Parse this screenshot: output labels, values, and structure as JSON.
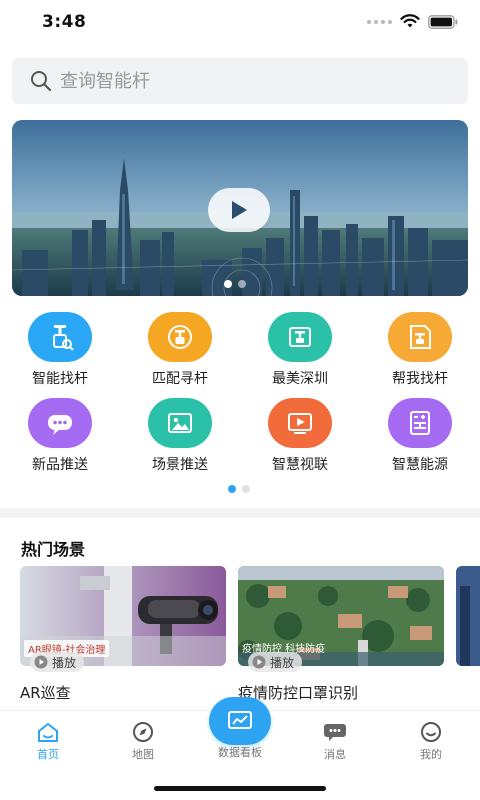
{
  "status_bar": {
    "time": "3:48"
  },
  "search": {
    "placeholder": "查询智能杆"
  },
  "functions": [
    {
      "label": "智能找杆",
      "icon": "pole-search-icon",
      "color": "#2aa7f5"
    },
    {
      "label": "匹配寻杆",
      "icon": "pole-match-icon",
      "color": "#f5a623"
    },
    {
      "label": "最美深圳",
      "icon": "pole-gallery-icon",
      "color": "#2bc1a8"
    },
    {
      "label": "帮我找杆",
      "icon": "pole-document-icon",
      "color": "#f7a935"
    },
    {
      "label": "新品推送",
      "icon": "chat-bubble-icon",
      "color": "#a56bf2"
    },
    {
      "label": "场景推送",
      "icon": "scene-image-icon",
      "color": "#2bc1a8"
    },
    {
      "label": "智慧视联",
      "icon": "video-play-icon",
      "color": "#f26b3a"
    },
    {
      "label": "智慧能源",
      "icon": "battery-grid-icon",
      "color": "#a56bf2"
    }
  ],
  "hot_scenes": {
    "title": "热门场景",
    "play_label": "播放",
    "cards": [
      {
        "title": "AR巡查",
        "tag": "AR眼镜-社会治理"
      },
      {
        "title": "疫情防控口罩识别",
        "tag": "疫情防控  科技防疫"
      }
    ]
  },
  "tabs": [
    {
      "label": "首页",
      "icon": "home-icon",
      "active": true
    },
    {
      "label": "地图",
      "icon": "compass-icon",
      "active": false
    },
    {
      "label": "数据看板",
      "icon": "chart-icon",
      "active": false
    },
    {
      "label": "消息",
      "icon": "message-icon",
      "active": false
    },
    {
      "label": "我的",
      "icon": "profile-icon",
      "active": false
    }
  ],
  "colors": {
    "accent": "#2ea3f2"
  }
}
